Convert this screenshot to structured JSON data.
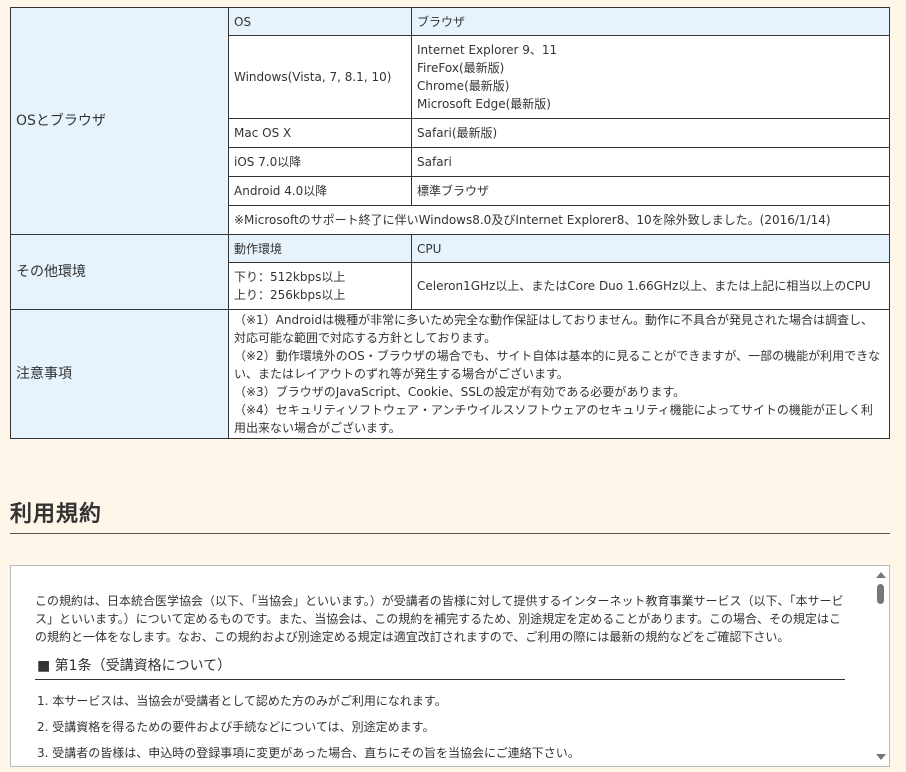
{
  "requirements": {
    "os_browser": {
      "label": "OSとブラウザ",
      "header_os": "OS",
      "header_browser": "ブラウザ",
      "rows": [
        {
          "os": "Windows(Vista, 7, 8.1, 10)",
          "browsers": [
            "Internet Explorer 9、11",
            "FireFox(最新版)",
            "Chrome(最新版)",
            "Microsoft Edge(最新版)"
          ]
        },
        {
          "os": "Mac OS X",
          "browsers": [
            "Safari(最新版)"
          ]
        },
        {
          "os": "iOS 7.0以降",
          "browsers": [
            "Safari"
          ]
        },
        {
          "os": "Android 4.0以降",
          "browsers": [
            "標準ブラウザ"
          ]
        }
      ],
      "note": "※Microsoftのサポート終了に伴いWindows8.0及びInternet Explorer8、10を除外致しました。(2016/1/14)"
    },
    "other": {
      "label": "その他環境",
      "header_env": "動作環境",
      "header_cpu": "CPU",
      "down": "下り：512kbps以上",
      "up": "上り：256kbps以上",
      "cpu": "Celeron1GHz以上、またはCore Duo 1.66GHz以上、または上記に相当以上のCPU"
    },
    "notes": {
      "label": "注意事項",
      "items": [
        "（※1）Androidは機種が非常に多いため完全な動作保証はしておりません。動作に不具合が発見された場合は調査し、対応可能な範囲で対応する方針としております。",
        "（※2）動作環境外のOS・ブラウザの場合でも、サイト自体は基本的に見ることができますが、一部の機能が利用できない、またはレイアウトのずれ等が発生する場合がございます。",
        "（※3）ブラウザのJavaScript、Cookie、SSLの設定が有効である必要があります。",
        "（※4）セキュリティソフトウェア・アンチウイルスソフトウェアのセキュリティ機能によってサイトの機能が正しく利用出来ない場合がございます。"
      ]
    }
  },
  "terms": {
    "title": "利用規約",
    "intro": "この規約は、日本統合医学協会（以下、「当協会」といいます。）が受講者の皆様に対して提供するインターネット教育事業サービス（以下、「本サービス」といいます。）について定めるものです。また、当協会は、この規約を補完するため、別途規定を定めることがあります。この場合、その規定はこの規約と一体をなします。なお、この規約および別途定める規定は適宜改訂されますので、ご利用の際には最新の規約などをご確認下さい。",
    "article1_title": "■ 第1条（受講資格について）",
    "article1_items": [
      "1. 本サービスは、当協会が受講者として認めた方のみがご利用になれます。",
      "2. 受講資格を得るための要件および手続などについては、別途定めます。",
      "3. 受講者の皆様は、申込時の登録事項に変更があった場合、直ちにその旨を当協会にご連絡下さい。"
    ]
  }
}
